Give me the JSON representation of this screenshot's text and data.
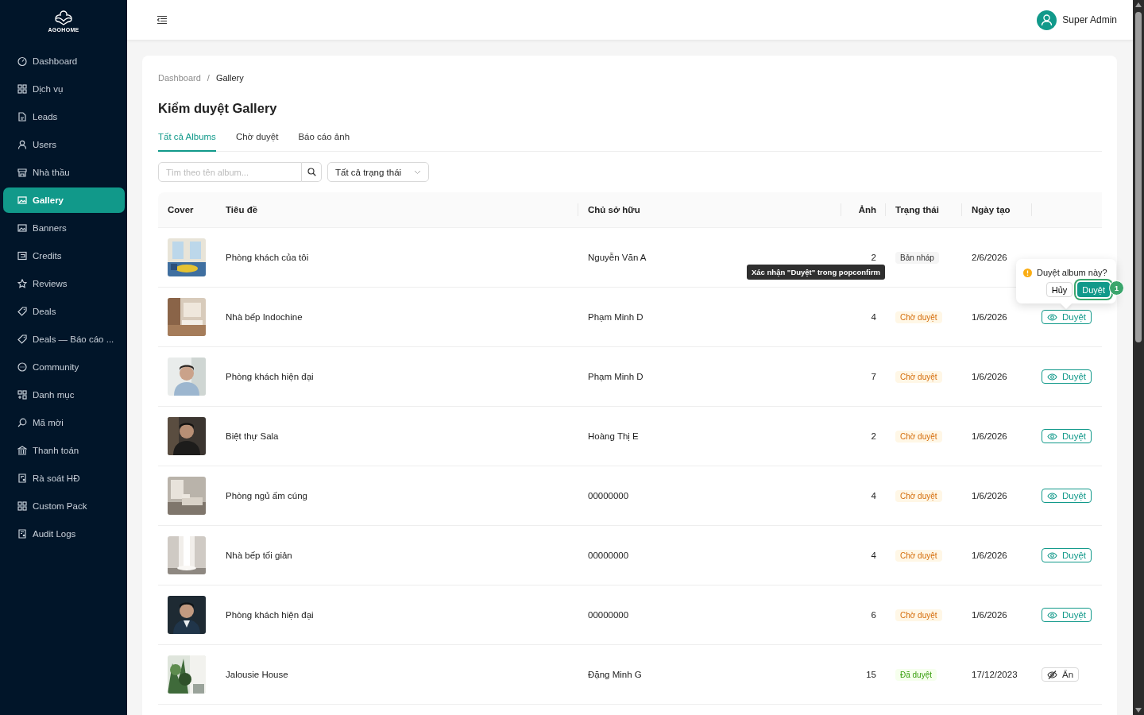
{
  "sidebar": {
    "logo": "AGOHOME",
    "items": [
      {
        "label": "Dashboard",
        "selected": false
      },
      {
        "label": "Dịch vụ",
        "selected": false
      },
      {
        "label": "Leads",
        "selected": false
      },
      {
        "label": "Users",
        "selected": false
      },
      {
        "label": "Nhà thầu",
        "selected": false
      },
      {
        "label": "Gallery",
        "selected": true
      },
      {
        "label": "Banners",
        "selected": false
      },
      {
        "label": "Credits",
        "selected": false
      },
      {
        "label": "Reviews",
        "selected": false
      },
      {
        "label": "Deals",
        "selected": false
      },
      {
        "label": "Deals — Báo cáo ...",
        "selected": false
      },
      {
        "label": "Community",
        "selected": false
      },
      {
        "label": "Danh mục",
        "selected": false
      },
      {
        "label": "Mã mời",
        "selected": false
      },
      {
        "label": "Thanh toán",
        "selected": false
      },
      {
        "label": "Rà soát HĐ",
        "selected": false
      },
      {
        "label": "Custom Pack",
        "selected": false
      },
      {
        "label": "Audit Logs",
        "selected": false
      }
    ]
  },
  "header": {
    "user": "Super Admin"
  },
  "breadcrumb": {
    "items": [
      "Dashboard",
      "Gallery"
    ],
    "separator": "/"
  },
  "title": "Kiểm duyệt Gallery",
  "tabs": [
    {
      "label": "Tất cả Albums",
      "selected": true
    },
    {
      "label": "Chờ duyệt",
      "selected": false
    },
    {
      "label": "Báo cáo ảnh",
      "selected": false
    }
  ],
  "filters": {
    "search": {
      "placeholder": "Tìm theo tên album..."
    },
    "status_select": "Tất cả trạng thái"
  },
  "table": {
    "columns": [
      "Cover",
      "Tiêu đề",
      "Chủ sở hữu",
      "Ảnh",
      "Trạng thái",
      "Ngày tạo"
    ],
    "rows": [
      {
        "title": "Phòng khách của tôi",
        "owner": "Nguyễn Văn A",
        "photos": "2",
        "status": {
          "label": "Bản nháp",
          "kind": "draft"
        },
        "created": "2/6/2026"
      },
      {
        "title": "Nhà bếp Indochine",
        "owner": "Phạm Minh D",
        "photos": "4",
        "status": {
          "label": "Chờ duyệt",
          "kind": "pending"
        },
        "created": "1/6/2026",
        "action": {
          "label": "Duyệt",
          "kind": "approve"
        }
      },
      {
        "title": "Phòng khách hiện đại",
        "owner": "Phạm Minh D",
        "photos": "7",
        "status": {
          "label": "Chờ duyệt",
          "kind": "pending"
        },
        "created": "1/6/2026",
        "action": {
          "label": "Duyệt",
          "kind": "approve"
        }
      },
      {
        "title": "Biệt thự Sala",
        "owner": "Hoàng Thị E",
        "photos": "2",
        "status": {
          "label": "Chờ duyệt",
          "kind": "pending"
        },
        "created": "1/6/2026",
        "action": {
          "label": "Duyệt",
          "kind": "approve"
        }
      },
      {
        "title": "Phòng ngủ ấm cúng",
        "owner": "00000000",
        "photos": "4",
        "status": {
          "label": "Chờ duyệt",
          "kind": "pending"
        },
        "created": "1/6/2026",
        "action": {
          "label": "Duyệt",
          "kind": "approve"
        }
      },
      {
        "title": "Nhà bếp tối giản",
        "owner": "00000000",
        "photos": "4",
        "status": {
          "label": "Chờ duyệt",
          "kind": "pending"
        },
        "created": "1/6/2026",
        "action": {
          "label": "Duyệt",
          "kind": "approve"
        }
      },
      {
        "title": "Phòng khách hiện đại",
        "owner": "00000000",
        "photos": "6",
        "status": {
          "label": "Chờ duyệt",
          "kind": "pending"
        },
        "created": "1/6/2026",
        "action": {
          "label": "Duyệt",
          "kind": "approve"
        }
      },
      {
        "title": "Jalousie House",
        "owner": "Đặng Minh G",
        "photos": "15",
        "status": {
          "label": "Đã duyệt",
          "kind": "approved"
        },
        "created": "17/12/2023",
        "action": {
          "label": "Ẩn",
          "kind": "hide"
        }
      }
    ]
  },
  "tooltip": "Xác nhận \"Duyệt\" trong popconfirm",
  "popconfirm": {
    "title": "Duyệt album này?",
    "cancel": "Hủy",
    "confirm": "Duyệt",
    "step": "1"
  }
}
